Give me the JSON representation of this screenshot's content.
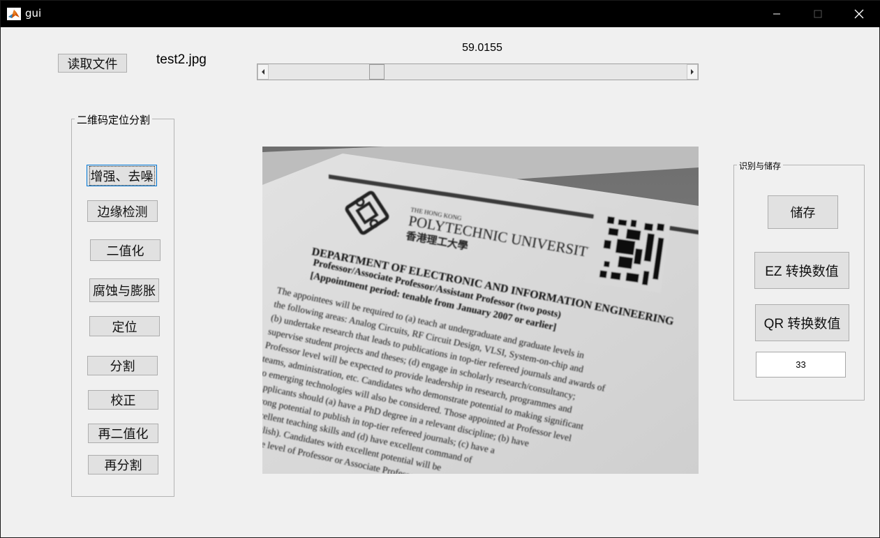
{
  "window": {
    "title": "gui"
  },
  "top": {
    "read_button": "读取文件",
    "file_name": "test2.jpg",
    "slider_value_text": "59.0155",
    "slider_fraction": 0.25
  },
  "left_group": {
    "title": "二维码定位分割",
    "buttons": [
      "增强、去噪",
      "边缘检测",
      "二值化",
      "腐蚀与膨胀",
      "定位",
      "分割",
      "校正",
      "再二值化",
      "再分割"
    ]
  },
  "right_group": {
    "title": "识别与储存",
    "store_button": "储存",
    "ez_button": "EZ 转换数值",
    "qr_button": "QR 转换数值",
    "value": "33"
  },
  "image": {
    "header_small": "THE HONG KONG",
    "header_big": "POLYTECHNIC UNIVERSITY",
    "header_chinese": "香港理工大學",
    "dept": "DEPARTMENT OF ELECTRONIC AND INFORMATION ENGINEERING",
    "line1": "Professor/Associate Professor/Assistant Professor (two posts)",
    "line2": "[Appointment period: tenable from January 2007 or earlier]",
    "body": [
      "The appointees will be required to (a) teach at undergraduate and graduate levels in",
      "the following areas: Analog Circuits, RF Circuit Design, VLSI, System-on-chip and",
      "(b) undertake research that leads to publications in top-tier refereed journals and awards of",
      "supervise student projects and theses; (d) engage in scholarly research/consultancy;",
      "Professor level will be expected to provide leadership in research, programmes and",
      "teams, administration, etc. Candidates who demonstrate potential to making significant",
      "to emerging technologies will also be considered. Those appointed at Professor level",
      "Applicants should (a) have a PhD degree in a relevant discipline; (b) have",
      "strong potential to publish in top-tier refereed journals; (c) have a",
      "excellent teaching skills and (d) have excellent command of",
      "English). Candidates with excellent potential will be",
      "at the level of Professor or Associate Professor"
    ]
  }
}
